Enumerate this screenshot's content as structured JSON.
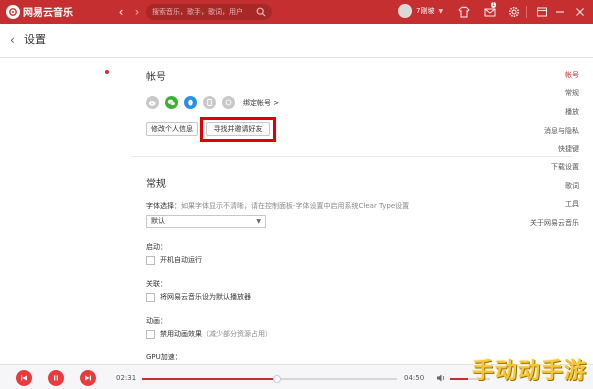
{
  "app": {
    "logo_text": "网易云音乐"
  },
  "topbar": {
    "search_placeholder": "搜索音乐，歌手，歌词，用户",
    "username": "7刚坡",
    "mail_badge": "1"
  },
  "header": {
    "title": "设置"
  },
  "sidebar": {
    "items": [
      {
        "label": "帐号",
        "active": true
      },
      {
        "label": "常规",
        "active": false
      },
      {
        "label": "播放",
        "active": false
      },
      {
        "label": "消息与隐私",
        "active": false
      },
      {
        "label": "快捷键",
        "active": false
      },
      {
        "label": "下载设置",
        "active": false
      },
      {
        "label": "歌词",
        "active": false
      },
      {
        "label": "工具",
        "active": false
      },
      {
        "label": "关于网易云音乐",
        "active": false
      }
    ]
  },
  "account": {
    "title": "帐号",
    "bind_link": "绑定帐号 >",
    "edit_profile_button": "修改个人信息",
    "find_friends_button": "寻找并邀请好友"
  },
  "general": {
    "title": "常规",
    "font_label": "字体选择：",
    "font_hint": "如果字体显示不清晰，请在控制面板-字体设置中启用系统Clear Type设置",
    "font_value": "默认",
    "startup_label": "启动：",
    "startup_option": "开机自动运行",
    "associate_label": "关联：",
    "associate_option": "将网易云音乐设为默认播放器",
    "animation_label": "动画：",
    "animation_option": "禁用动画效果",
    "animation_hint": "（减少部分资源占用）",
    "gpu_label": "GPU加速："
  },
  "player": {
    "current_time": "02:31",
    "total_time": "04:50",
    "progress": 0.53,
    "volume": 0.45
  },
  "watermark": {
    "text": "手动动手游"
  },
  "colors": {
    "accent": "#c62f2f",
    "highlight": "#e00000",
    "wechat": "#3cb034",
    "qq": "#2a8fe8"
  }
}
